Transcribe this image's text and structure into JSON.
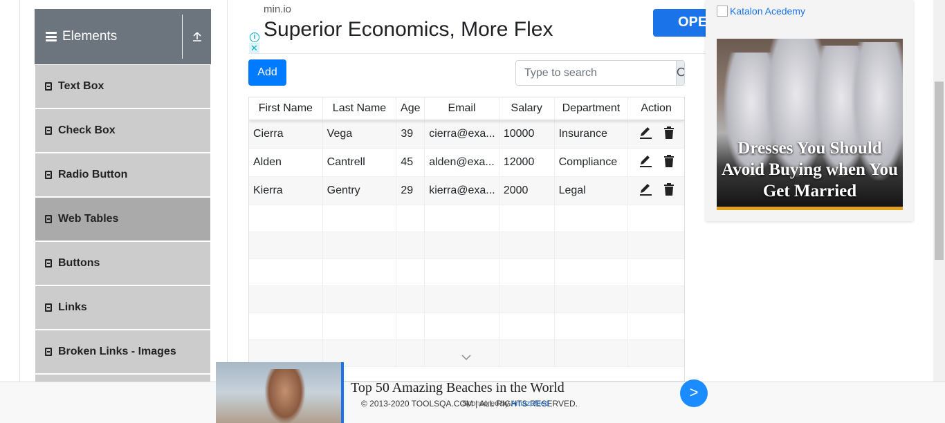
{
  "sidebar": {
    "group_title": "Elements",
    "items": [
      {
        "label": "Text Box"
      },
      {
        "label": "Check Box"
      },
      {
        "label": "Radio Button"
      },
      {
        "label": "Web Tables"
      },
      {
        "label": "Buttons"
      },
      {
        "label": "Links"
      },
      {
        "label": "Broken Links - Images"
      }
    ],
    "active_item": "Web Tables"
  },
  "ad_top": {
    "domain": "min.io",
    "headline": "Superior Economics, More Flex",
    "cta": "OPE",
    "info_icon": "i",
    "close_icon": "✕"
  },
  "toolbar": {
    "add_label": "Add",
    "search_placeholder": "Type to search"
  },
  "table": {
    "headers": [
      "First Name",
      "Last Name",
      "Age",
      "Email",
      "Salary",
      "Department",
      "Action"
    ],
    "rows": [
      [
        "Cierra",
        "Vega",
        "39",
        "cierra@exa...",
        "10000",
        "Insurance"
      ],
      [
        "Alden",
        "Cantrell",
        "45",
        "alden@exa...",
        "12000",
        "Compliance"
      ],
      [
        "Kierra",
        "Gentry",
        "29",
        "kierra@exa...",
        "2000",
        "Legal"
      ]
    ]
  },
  "ad_right": {
    "link_text": "Katalon Acedemy",
    "image_text": "Dresses You Should Avoid Buying when You Get Married"
  },
  "ad_bottom": {
    "title": "Top 50 Amazing Beaches in the World",
    "sponsor_prefix": "Sponsored by",
    "sponsor_name": "Amazefeed",
    "next": ">"
  },
  "footer": {
    "text": "© 2013-2020 TOOLSQA.COM | ALL RIGHTS RESERVED."
  },
  "colors": {
    "primary": "#007bff",
    "sidebar_header": "#6c757d",
    "sidebar_item": "#cccccc",
    "sidebar_active": "#aaaaaa"
  }
}
